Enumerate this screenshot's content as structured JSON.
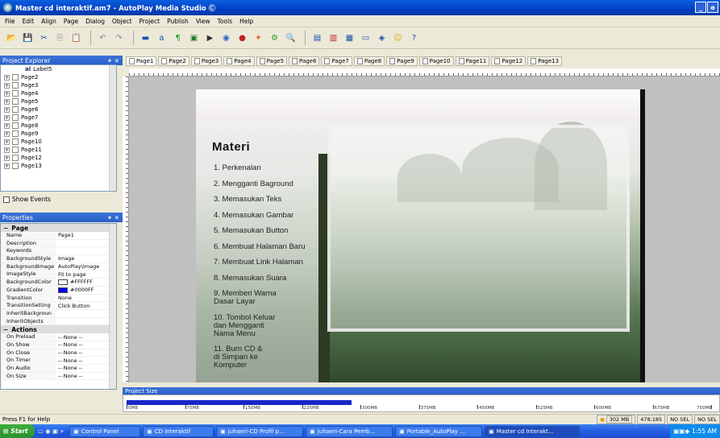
{
  "window": {
    "title": "Master cd interaktif.am7 - AutoPlay Media Studio Ⓒ",
    "minimize": "_",
    "restore": "ə"
  },
  "menu": [
    "File",
    "Edit",
    "Align",
    "Page",
    "Dialog",
    "Object",
    "Project",
    "Publish",
    "View",
    "Tools",
    "Help"
  ],
  "toolbar": {
    "icons": [
      "open-icon",
      "save-icon",
      "cut-icon",
      "copy-icon",
      "paste-icon",
      "undo-icon",
      "redo-icon",
      "button-icon",
      "label-icon",
      "paragraph-icon",
      "image-icon",
      "video-icon",
      "web-icon",
      "flash-icon",
      "xbutton-icon",
      "plugin-icon",
      "search-icon",
      "page-icon",
      "new-page-icon",
      "properties-icon",
      "preview-icon",
      "global-icon",
      "script-icon",
      "help-icon"
    ]
  },
  "project_explorer": {
    "title": "Project Explorer",
    "pin": "✶ ✕",
    "label_row": "Label5",
    "pages": [
      "Page2",
      "Page3",
      "Page4",
      "Page5",
      "Page6",
      "Page7",
      "Page8",
      "Page9",
      "Page10",
      "Page11",
      "Page12",
      "Page13"
    ],
    "show_events": "Show Events"
  },
  "properties": {
    "title": "Properties",
    "pin": "✶ ✕",
    "section_page": "Page",
    "rows": [
      {
        "k": "Name",
        "v": "Page1"
      },
      {
        "k": "Description",
        "v": ""
      },
      {
        "k": "Keywords",
        "v": ""
      },
      {
        "k": "BackgroundStyle",
        "v": "Image"
      },
      {
        "k": "BackgroundImage",
        "v": "AutoPlay\\Image"
      },
      {
        "k": "ImageStyle",
        "v": "Fit to page"
      },
      {
        "k": "BackgroundColor",
        "v": "#FFFFFF",
        "swatch": "#ffffff"
      },
      {
        "k": "GradientColor",
        "v": "#0000FF",
        "swatch": "#0000ff"
      },
      {
        "k": "Transition",
        "v": "None"
      },
      {
        "k": "TransitionSetting",
        "v": "Click Button"
      },
      {
        "k": "InheritBackgroun",
        "v": ""
      },
      {
        "k": "InheritObjects",
        "v": ""
      }
    ],
    "section_actions": "Actions",
    "actions": [
      {
        "k": "On Preload",
        "v": "-- None --"
      },
      {
        "k": "On Show",
        "v": "-- None --"
      },
      {
        "k": "On Close",
        "v": "-- None --"
      },
      {
        "k": "On Timer",
        "v": "-- None --"
      },
      {
        "k": "On Audio",
        "v": "-- None --"
      },
      {
        "k": "On Size",
        "v": "-- None --"
      }
    ]
  },
  "tabs": [
    "Page1",
    "Page2",
    "Page3",
    "Page4",
    "Page5",
    "Page6",
    "Page7",
    "Page8",
    "Page9",
    "Page10",
    "Page11",
    "Page12",
    "Page13"
  ],
  "stage": {
    "heading": "Materi",
    "items": [
      "1. Perkenalan",
      "2. Mengganti Baground",
      "3. Memasukan Teks",
      "4. Memasukan Gambar",
      "5. Memasukan Button",
      "6. Membuat Halaman Baru",
      "7. Membuat Link Halaman",
      "8. Memasukan Suara",
      "9. Memberi Warna Dasar Layar",
      "10. Tombol Keluar dan Mengganti Nama Menu",
      "11. Burn CD & di Simpan ke Komputer"
    ]
  },
  "project_size": {
    "title": "Project Size",
    "fill_fraction": 0.38,
    "ticks": [
      "0MB",
      "75MB",
      "150MB",
      "225MB",
      "300MB",
      "375MB",
      "450MB",
      "525MB",
      "600MB",
      "675MB",
      "750MB"
    ]
  },
  "status": {
    "text": "Press F1 for Help",
    "size": "302 MB",
    "count": "478,185",
    "nosel1": "NO SEL",
    "nosel2": "NO SEL"
  },
  "taskbar": {
    "start": "Start",
    "items": [
      "Control Panel",
      "CD Interaktif",
      "juhaeri-CD Profil p...",
      "juhaeri-Cara Pemb...",
      "Portable_AutoPlay ...",
      "Master cd Interakt..."
    ],
    "time": "1:55 AM"
  }
}
